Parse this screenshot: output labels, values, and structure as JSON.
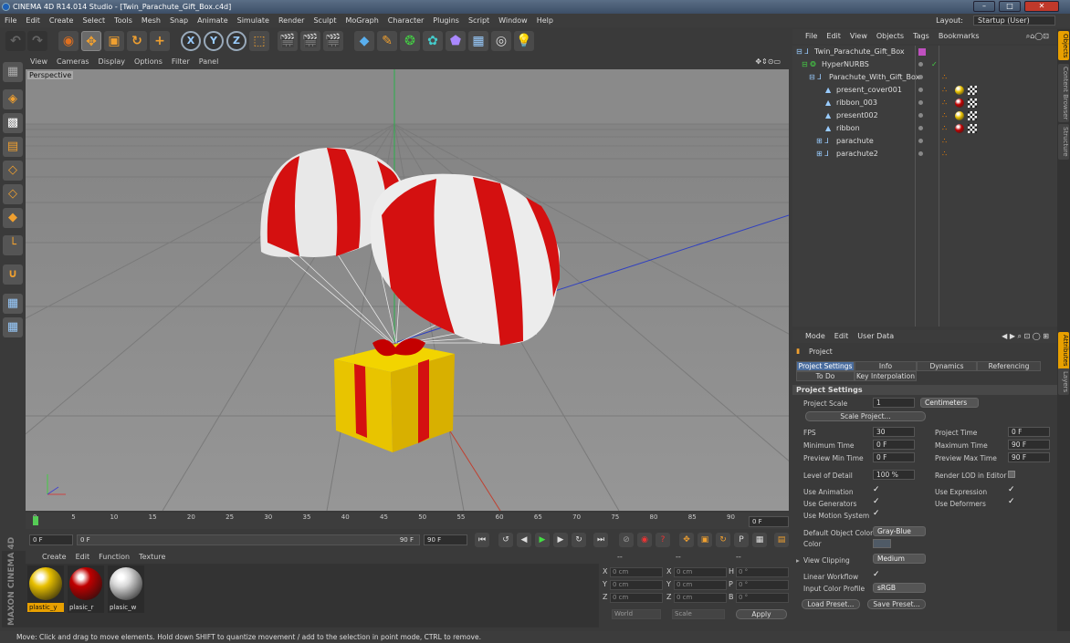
{
  "window": {
    "title": "CINEMA 4D R14.014 Studio - [Twin_Parachute_Gift_Box.c4d]"
  },
  "menubar": {
    "items": [
      "File",
      "Edit",
      "Create",
      "Select",
      "Tools",
      "Mesh",
      "Snap",
      "Animate",
      "Simulate",
      "Render",
      "Sculpt",
      "MoGraph",
      "Character",
      "Plugins",
      "Script",
      "Window",
      "Help"
    ],
    "layout_label": "Layout:",
    "layout_value": "Startup (User)"
  },
  "viewport": {
    "menu": [
      "View",
      "Cameras",
      "Display",
      "Options",
      "Filter",
      "Panel"
    ],
    "label": "Perspective"
  },
  "timeline": {
    "ticks": [
      "0",
      "5",
      "10",
      "15",
      "20",
      "25",
      "30",
      "35",
      "40",
      "45",
      "50",
      "55",
      "60",
      "65",
      "70",
      "75",
      "80",
      "85",
      "90"
    ],
    "current_frame": "0 F"
  },
  "transport": {
    "start_field": "0 F",
    "slider_start": "0 F",
    "slider_end": "90 F",
    "end_field": "90 F"
  },
  "material_manager": {
    "menu": [
      "Create",
      "Edit",
      "Function",
      "Texture"
    ],
    "materials": [
      {
        "name": "plastic_y",
        "color": "#e8c000"
      },
      {
        "name": "plasic_r",
        "color": "#c00000"
      },
      {
        "name": "plasic_w",
        "color": "#d8d8d8"
      }
    ]
  },
  "coordinates": {
    "header1": "--",
    "header2": "--",
    "header3": "--",
    "rows": [
      {
        "a": "X",
        "av": "0 cm",
        "b": "X",
        "bv": "0 cm",
        "c": "H",
        "cv": "0 °"
      },
      {
        "a": "Y",
        "av": "0 cm",
        "b": "Y",
        "bv": "0 cm",
        "c": "P",
        "cv": "0 °"
      },
      {
        "a": "Z",
        "av": "0 cm",
        "b": "Z",
        "bv": "0 cm",
        "c": "B",
        "cv": "0 °"
      }
    ],
    "mode1": "World",
    "mode2": "Scale",
    "apply": "Apply"
  },
  "status": {
    "text": "Move: Click and drag to move elements. Hold down SHIFT to quantize movement / add to the selection in point mode, CTRL to remove."
  },
  "object_manager": {
    "menu": [
      "File",
      "Edit",
      "View",
      "Objects",
      "Tags",
      "Bookmarks"
    ],
    "objects": [
      {
        "name": "Twin_Parachute_Gift_Box",
        "tags": []
      },
      {
        "name": "HyperNURBS",
        "tags": []
      },
      {
        "name": "Parachute_With_Gift_Box",
        "tags": []
      },
      {
        "name": "present_cover001",
        "tags": [
          "#e8c000"
        ]
      },
      {
        "name": "ribbon_003",
        "tags": [
          "#c00000"
        ]
      },
      {
        "name": "present002",
        "tags": [
          "#e8c000"
        ]
      },
      {
        "name": "ribbon",
        "tags": [
          "#c00000"
        ]
      },
      {
        "name": "parachute",
        "tags": []
      },
      {
        "name": "parachute2",
        "tags": []
      }
    ]
  },
  "side_tabs": [
    "Objects",
    "Content Browser",
    "Structure",
    "Attributes",
    "Layers"
  ],
  "attributes": {
    "menu": [
      "Mode",
      "Edit",
      "User Data"
    ],
    "object_label": "Project",
    "tabs": [
      "Project Settings",
      "Info",
      "Dynamics",
      "Referencing",
      "To Do",
      "Key Interpolation"
    ],
    "section": "Project Settings",
    "project_scale_label": "Project Scale",
    "project_scale_value": "1",
    "project_scale_unit": "Centimeters",
    "scale_button": "Scale Project...",
    "fps_label": "FPS",
    "fps_value": "30",
    "project_time_label": "Project Time",
    "project_time_value": "0 F",
    "min_time_label": "Minimum Time",
    "min_time_value": "0 F",
    "max_time_label": "Maximum Time",
    "max_time_value": "90 F",
    "prev_min_label": "Preview Min Time",
    "prev_min_value": "0 F",
    "prev_max_label": "Preview Max Time",
    "prev_max_value": "90 F",
    "lod_label": "Level of Detail",
    "lod_value": "100 %",
    "render_lod_label": "Render LOD in Editor",
    "use_animation": "Use Animation",
    "use_expression": "Use Expression",
    "use_generators": "Use Generators",
    "use_deformers": "Use Deformers",
    "use_motion": "Use Motion System",
    "default_color_label": "Default Object Color",
    "default_color_value": "Gray-Blue",
    "color_label": "Color",
    "view_clipping_label": "View Clipping",
    "view_clipping_value": "Medium",
    "linear_label": "Linear Workflow",
    "input_profile_label": "Input Color Profile",
    "input_profile_value": "sRGB",
    "load_preset": "Load Preset...",
    "save_preset": "Save Preset..."
  },
  "branding": {
    "logo_text": "MAXON CINEMA 4D"
  }
}
